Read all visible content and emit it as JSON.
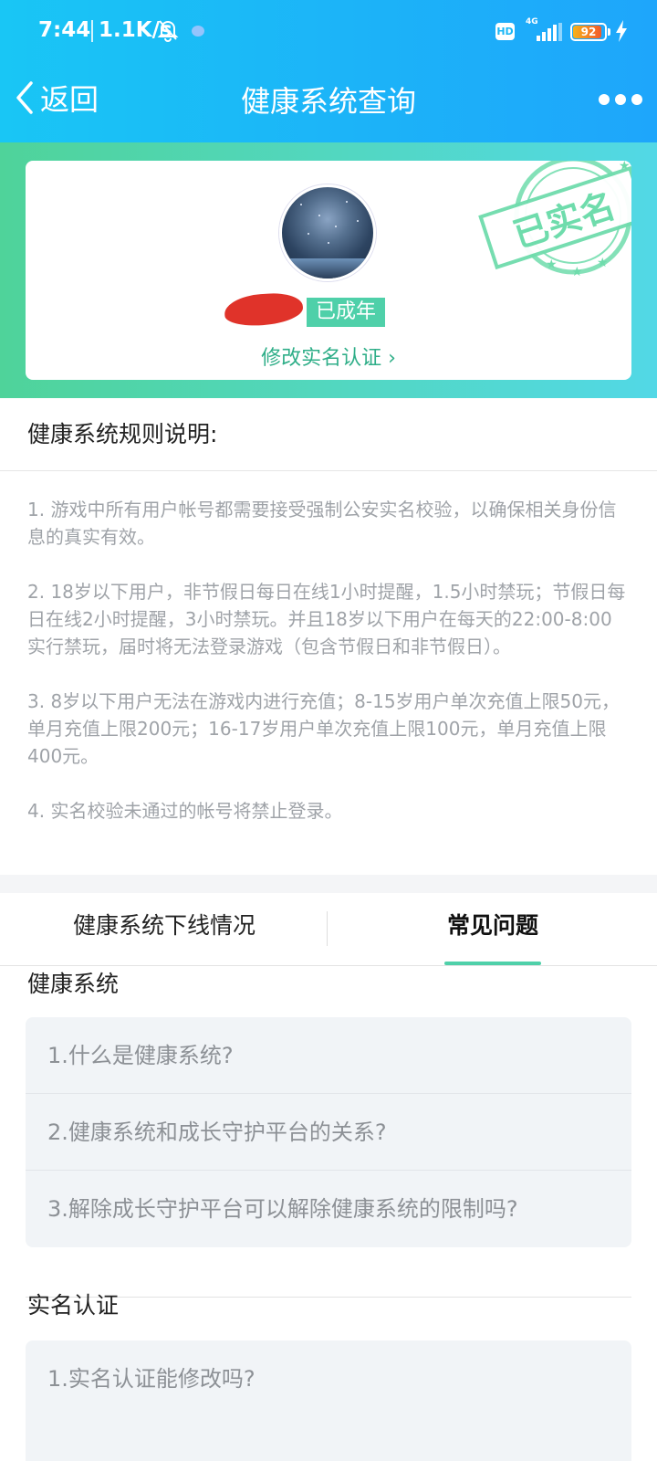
{
  "status_bar": {
    "time": "7:44",
    "net_speed": "1.1K/s",
    "hd": "HD",
    "network": "4G",
    "battery_level": "92",
    "battery_fraction": 0.92
  },
  "nav": {
    "back_label": "返回",
    "title": "健康系统查询"
  },
  "profile": {
    "badge": "已成年",
    "edit_link": "修改实名认证 ›",
    "stamp_text": "已实名"
  },
  "rules": {
    "heading": "健康系统规则说明:",
    "items": [
      "1. 游戏中所有用户帐号都需要接受强制公安实名校验，以确保相关身份信息的真实有效。",
      "2. 18岁以下用户，非节假日每日在线1小时提醒，1.5小时禁玩；节假日每日在线2小时提醒，3小时禁玩。并且18岁以下用户在每天的22:00-8:00实行禁玩，届时将无法登录游戏（包含节假日和非节假日）。",
      "3. 8岁以下用户无法在游戏内进行充值；8-15岁用户单次充值上限50元，单月充值上限200元；16-17岁用户单次充值上限100元，单月充值上限400元。",
      "4. 实名校验未通过的帐号将禁止登录。"
    ]
  },
  "tabs": [
    {
      "label": "健康系统下线情况",
      "active": false
    },
    {
      "label": "常见问题",
      "active": true
    }
  ],
  "faq": {
    "health": {
      "title": "健康系统",
      "items": [
        "1.什么是健康系统?",
        "2.健康系统和成长守护平台的关系?",
        "3.解除成长守护平台可以解除健康系统的限制吗?"
      ]
    },
    "realname": {
      "title": "实名认证",
      "items": [
        "1.实名认证能修改吗?"
      ]
    }
  },
  "colors": {
    "header_blue": "#1cb3f8",
    "accent_green": "#4fd0a9",
    "link_green": "#2fae88",
    "stamp_green": "#5fd6a3"
  }
}
